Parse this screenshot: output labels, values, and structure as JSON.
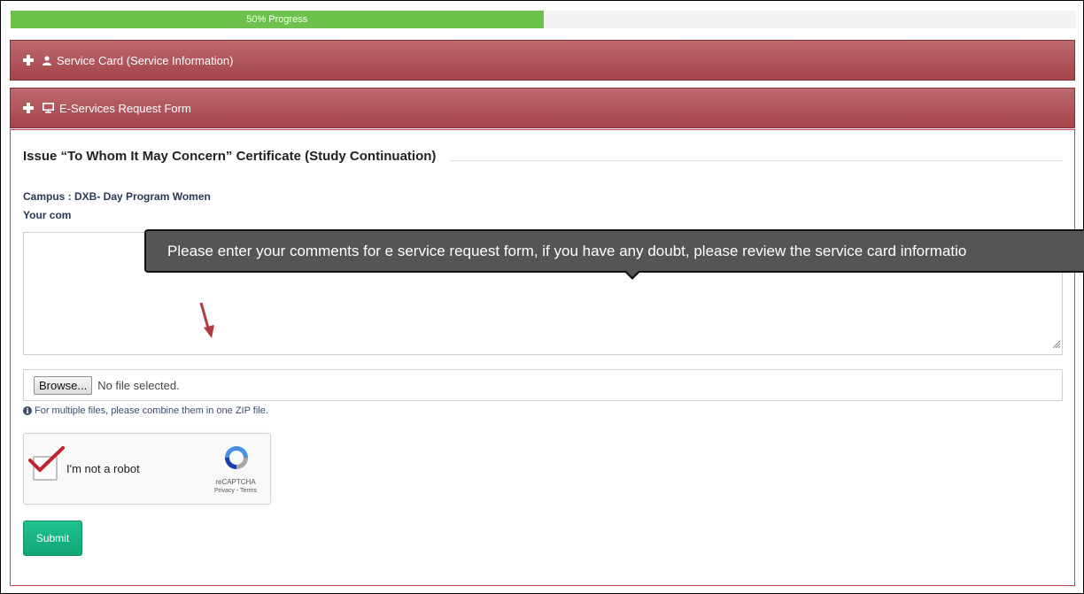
{
  "progress": {
    "label": "50% Progress",
    "percent": 50
  },
  "panels": [
    {
      "label": "Service Card (Service Information)",
      "icon": "user-icon"
    },
    {
      "label": "E-Services Request Form",
      "icon": "monitor-icon"
    }
  ],
  "form": {
    "title": "Issue “To Whom It May Concern” Certificate (Study Continuation)",
    "campus": "Campus : DXB- Day Program Women",
    "comment_label": "Your com",
    "tooltip": "Please enter your comments for e service request form, if you have any doubt, please review the service card informatio",
    "browse_label": "Browse...",
    "file_status": "No file selected.",
    "hint": "For multiple files, please combine them in one ZIP file.",
    "submit_label": "Submit"
  },
  "captcha": {
    "label": "I'm not a robot",
    "brand": "reCAPTCHA",
    "terms": "Privacy - Terms",
    "checked": true
  },
  "colors": {
    "progress": "#6cc24a",
    "panel_header": "#a5434a",
    "submit": "#13a677",
    "tooltip": "#555555",
    "check_mark": "#c0232c"
  }
}
